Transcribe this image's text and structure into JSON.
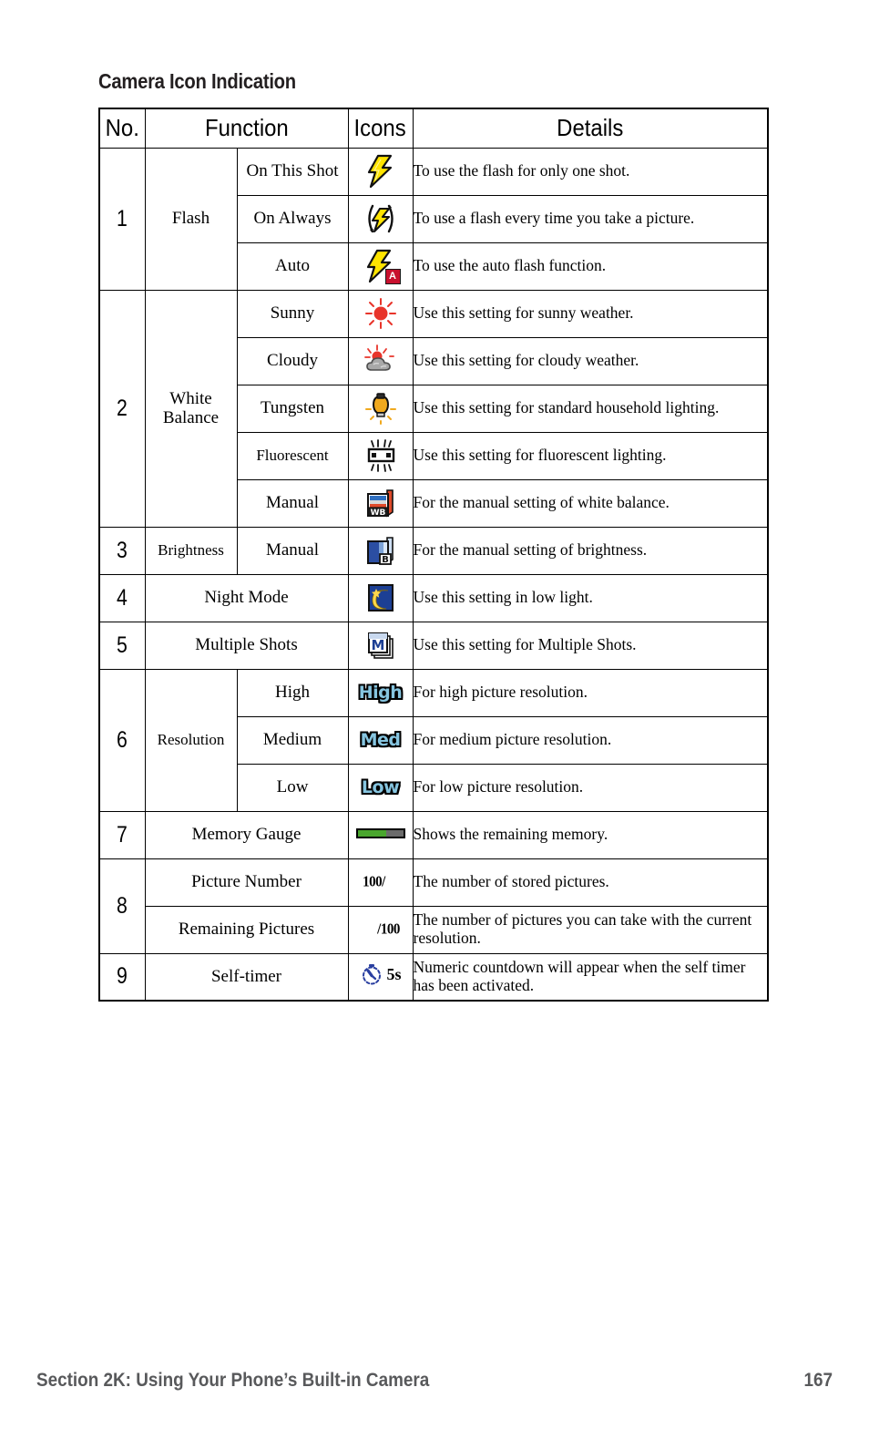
{
  "page": {
    "heading": "Camera Icon Indication",
    "footer_left": "Section 2K: Using Your Phone’s Built-in Camera",
    "footer_page": "167"
  },
  "table": {
    "columns": [
      "No.",
      "Function",
      "Icons",
      "Details"
    ],
    "rows": [
      {
        "no": "1",
        "function": "Flash",
        "items": [
          {
            "sub": "On This Shot",
            "icon": "flash-on-this-shot-icon",
            "details": "To use the flash for only one shot."
          },
          {
            "sub": "On Always",
            "icon": "flash-on-always-icon",
            "details": "To use a flash every time you take a picture."
          },
          {
            "sub": "Auto",
            "icon": "flash-auto-icon",
            "details": "To use the auto flash function."
          }
        ]
      },
      {
        "no": "2",
        "function": "White Balance",
        "items": [
          {
            "sub": "Sunny",
            "icon": "wb-sunny-icon",
            "details": "Use this setting for sunny weather."
          },
          {
            "sub": "Cloudy",
            "icon": "wb-cloudy-icon",
            "details": "Use this setting for cloudy weather."
          },
          {
            "sub": "Tungsten",
            "icon": "wb-tungsten-icon",
            "details": "Use this setting for standard household lighting."
          },
          {
            "sub": "Fluorescent",
            "icon": "wb-fluorescent-icon",
            "details": "Use this setting for fluorescent lighting."
          },
          {
            "sub": "Manual",
            "icon": "wb-manual-icon",
            "details": "For the manual setting of white balance."
          }
        ]
      },
      {
        "no": "3",
        "function": "Brightness",
        "items": [
          {
            "sub": "Manual",
            "icon": "brightness-manual-icon",
            "details": "For the manual setting of brightness."
          }
        ]
      },
      {
        "no": "4",
        "function": "Night Mode",
        "items": [
          {
            "sub": "",
            "icon": "night-mode-icon",
            "details": "Use this setting in low light."
          }
        ]
      },
      {
        "no": "5",
        "function": "Multiple Shots",
        "items": [
          {
            "sub": "",
            "icon": "multiple-shots-icon",
            "details": "Use this setting for Multiple Shots."
          }
        ]
      },
      {
        "no": "6",
        "function": "Resolution",
        "items": [
          {
            "sub": "High",
            "icon": "resolution-high-icon",
            "icon_text": "High",
            "details": "For high picture resolution."
          },
          {
            "sub": "Medium",
            "icon": "resolution-medium-icon",
            "icon_text": "Med",
            "details": "For medium picture resolution."
          },
          {
            "sub": "Low",
            "icon": "resolution-low-icon",
            "icon_text": "Low",
            "details": "For low picture resolution."
          }
        ]
      },
      {
        "no": "7",
        "function": "Memory Gauge",
        "items": [
          {
            "sub": "",
            "icon": "memory-gauge-icon",
            "details": "Shows the remaining memory."
          }
        ]
      },
      {
        "no": "8",
        "function": "",
        "items": [
          {
            "sub": "Picture Number",
            "icon": "picture-number-icon",
            "icon_text": "100/",
            "details": "The number of stored pictures."
          },
          {
            "sub": "Remaining Pictures",
            "icon": "remaining-pictures-icon",
            "icon_text": "/100",
            "details": "The number of pictures you can take with the current resolution."
          }
        ]
      },
      {
        "no": "9",
        "function": "Self-timer",
        "items": [
          {
            "sub": "",
            "icon": "self-timer-icon",
            "icon_text": "5s",
            "details": "Numeric countdown will appear when the self timer has been activated."
          }
        ]
      }
    ]
  },
  "colors": {
    "flash_yellow": "#ffe400",
    "auto_badge_red": "#c8102e",
    "sun_red": "#e8342a",
    "cloud_gray": "#9a9a9a",
    "bulb_orange": "#f0a91e",
    "brightness_blue": "#2b4ea2",
    "night_blue": "#1c3f94",
    "resolution_blue": "#86c5e0",
    "gauge_green": "#4aa72e",
    "gauge_gray": "#6b6b6b",
    "timer_blue": "#2a3fa0",
    "footer_gray": "#58595b"
  }
}
